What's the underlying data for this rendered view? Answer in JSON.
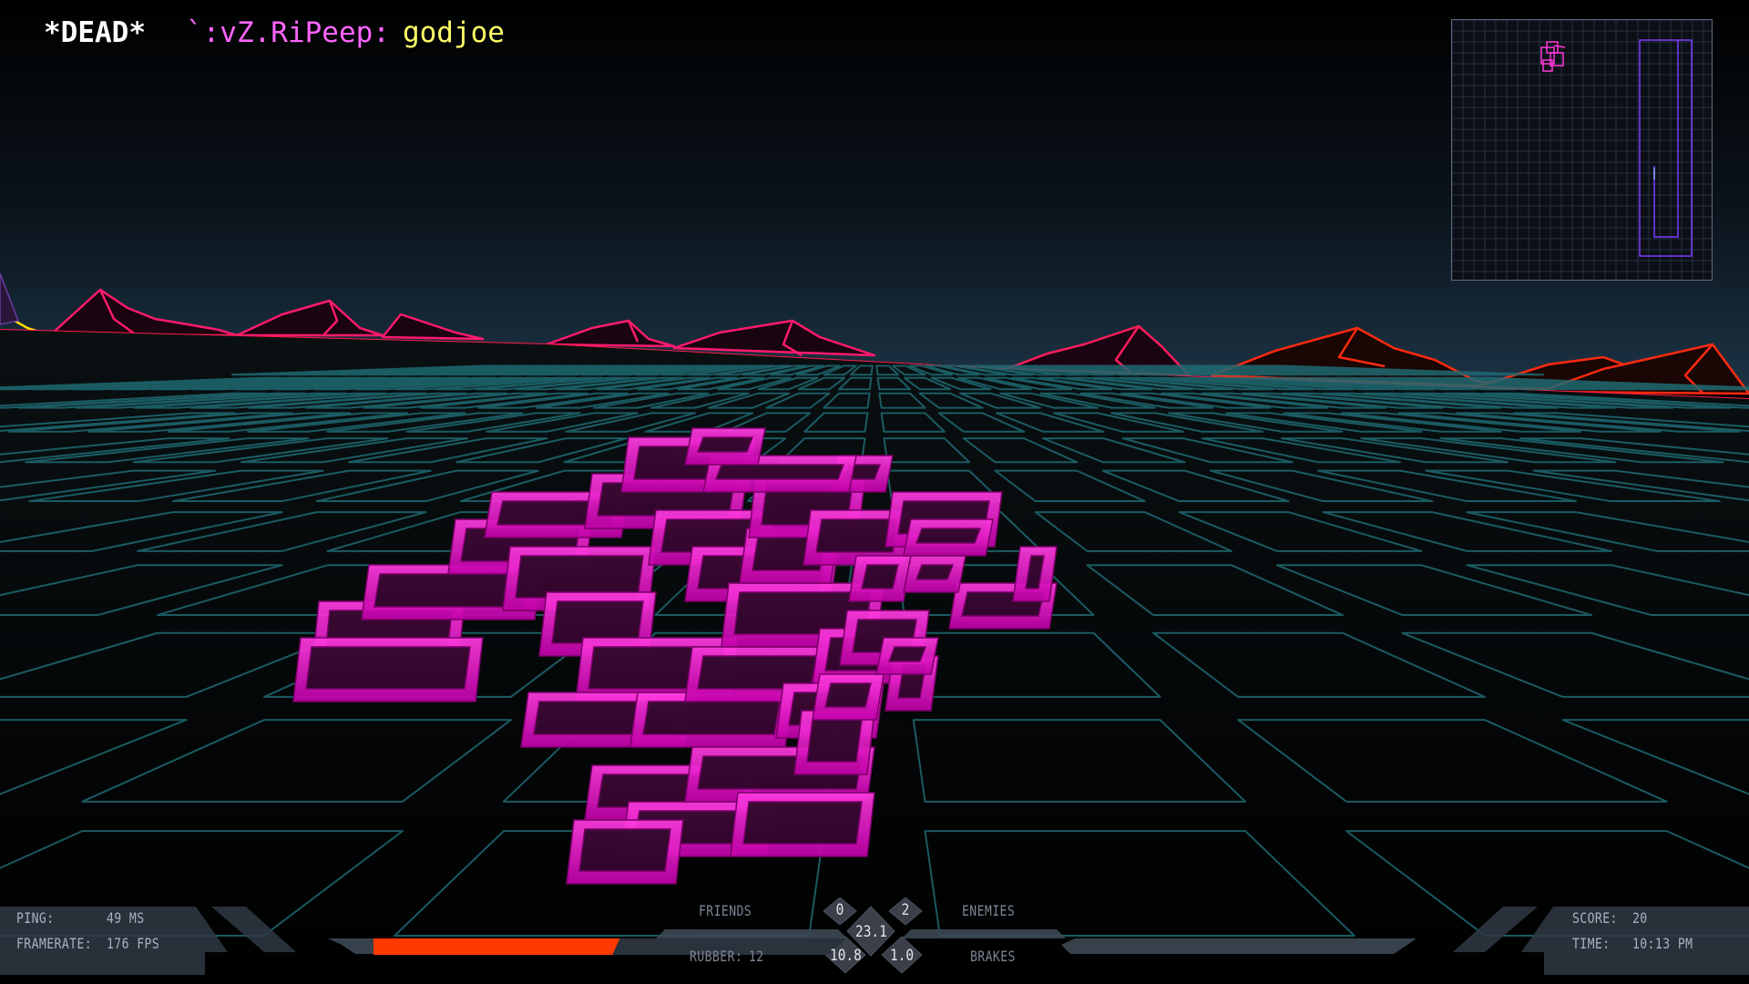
{
  "console": {
    "status": "*DEAD*",
    "player": "`:vZ.RiPeep:",
    "message": "godjoe"
  },
  "hud": {
    "ping_label": "PING:",
    "ping_value": "49 MS",
    "framerate_label": "FRAMERATE:",
    "framerate_value": "176 FPS",
    "friends_label": "FRIENDS",
    "friends_count": "0",
    "enemies_label": "ENEMIES",
    "enemies_count": "2",
    "speed": "23.1",
    "rubber_label": "RUBBER:",
    "rubber_value": "12",
    "rubber_meter": "10.8",
    "brakes_meter": "1.0",
    "brakes_label": "BRAKES",
    "score_label": "SCORE:",
    "score_value": "20",
    "time_label": "TIME:",
    "time_value": "10:13 PM",
    "speed_bar_fraction": 0.52
  },
  "colors": {
    "wall": "#ff14d2",
    "mountains_left": "#ff1a6e",
    "mountains_right": "#ff2a10",
    "grid": "#1e6f74",
    "sky_top": "#000000",
    "sky_horizon": "#1f3a4c",
    "hud_bar": "#ff3a00",
    "minimap_trail": "#7b3cff"
  }
}
